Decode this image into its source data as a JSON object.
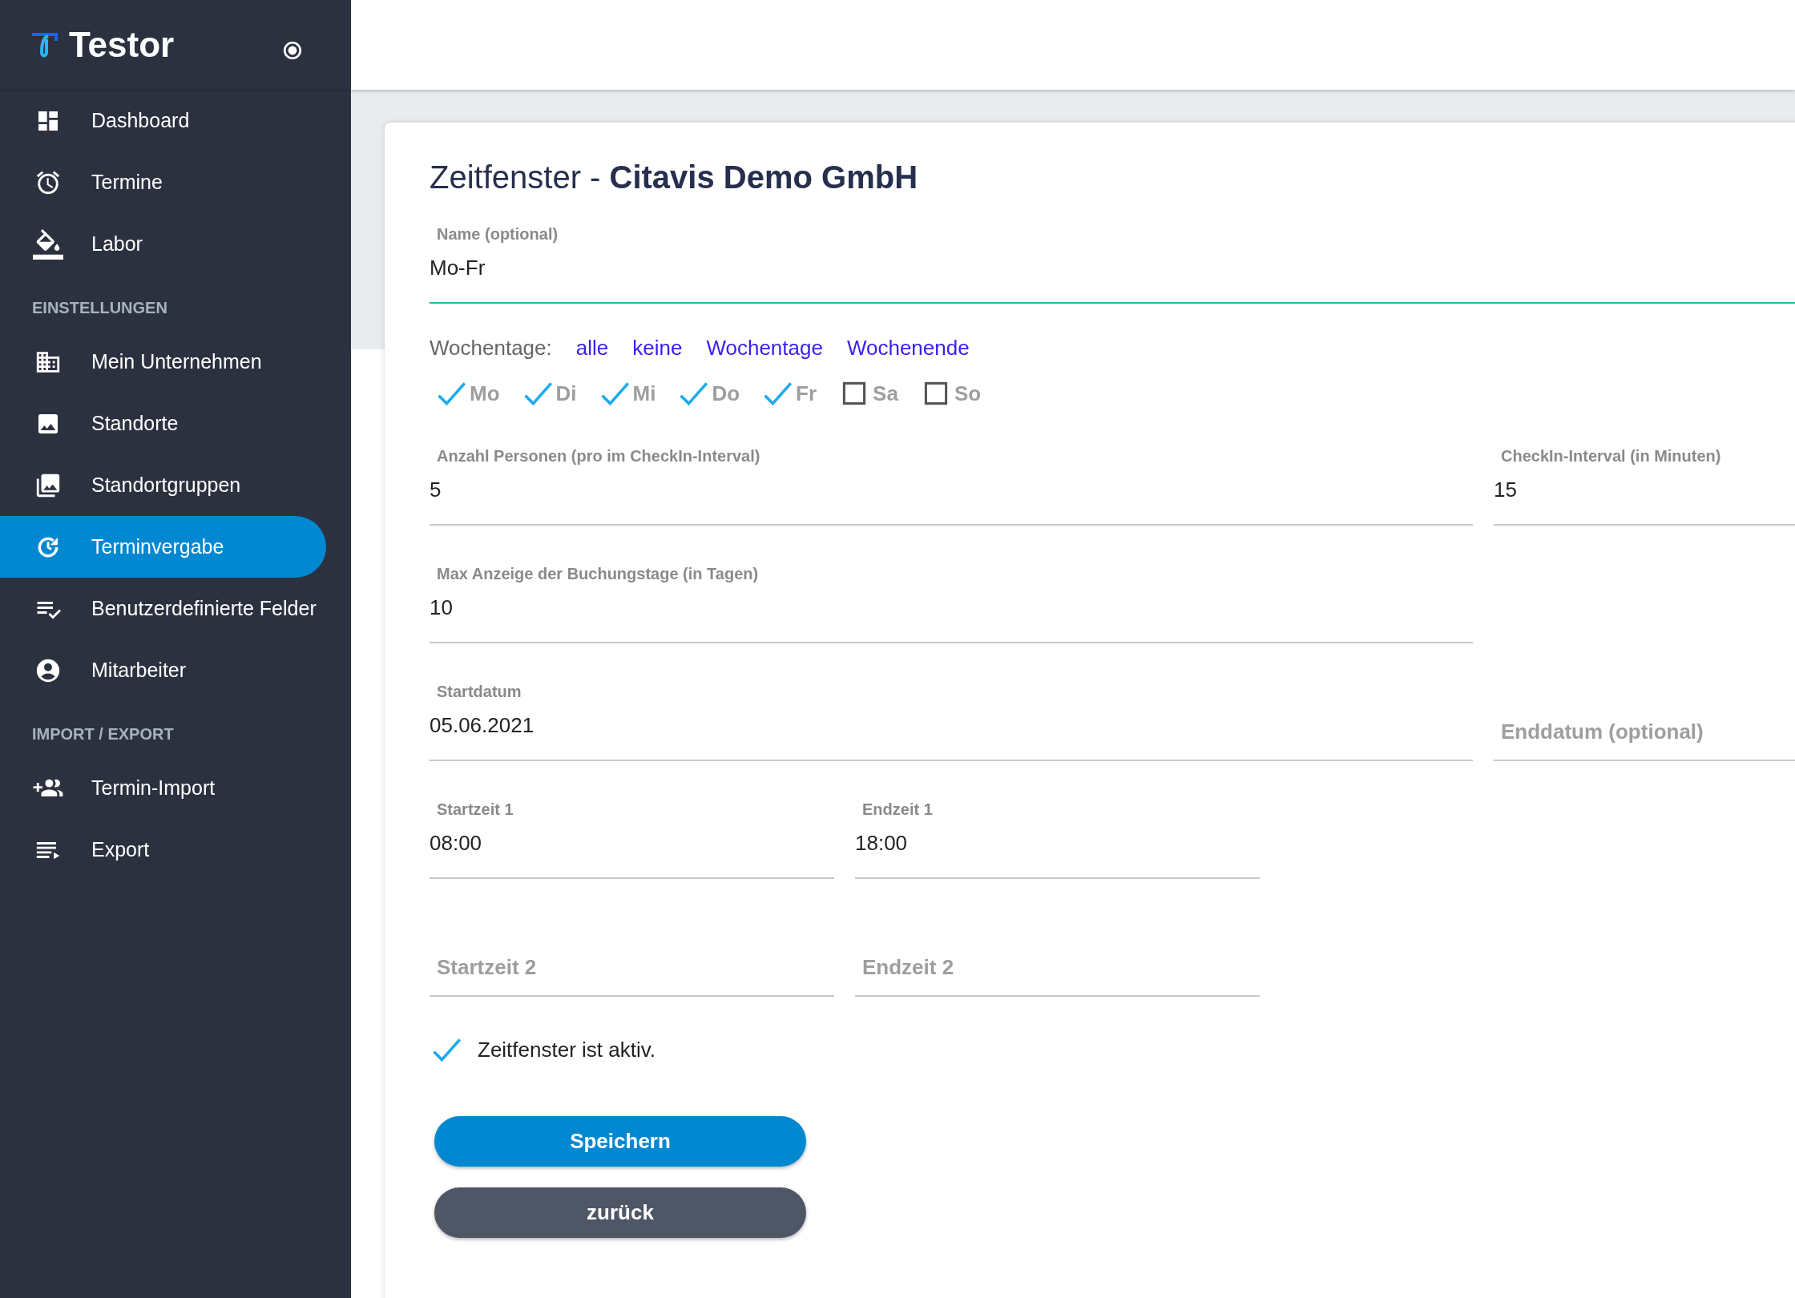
{
  "sidebar": {
    "brand": "Testor",
    "items": [
      {
        "kind": "link",
        "label": "Dashboard",
        "selected": false
      },
      {
        "kind": "link",
        "label": "Termine",
        "selected": false
      },
      {
        "kind": "link",
        "label": "Labor",
        "selected": false
      },
      {
        "kind": "section",
        "label": "EINSTELLUNGEN"
      },
      {
        "kind": "link",
        "label": "Mein Unternehmen",
        "selected": false
      },
      {
        "kind": "link",
        "label": "Standorte",
        "selected": false
      },
      {
        "kind": "link",
        "label": "Standortgruppen",
        "selected": false
      },
      {
        "kind": "link",
        "label": "Terminvergabe",
        "selected": true
      },
      {
        "kind": "link",
        "label": "Benutzerdefinierte Felder",
        "selected": false
      },
      {
        "kind": "link",
        "label": "Mitarbeiter",
        "selected": false
      },
      {
        "kind": "section",
        "label": "IMPORT / EXPORT"
      },
      {
        "kind": "link",
        "label": "Termin-Import",
        "selected": false
      },
      {
        "kind": "link",
        "label": "Export",
        "selected": false
      }
    ]
  },
  "form": {
    "title": "Zeitfenster - **Citavis Demo GmbH**",
    "name_field": {
      "label": "Name (optional)",
      "value": "Mo-Fr",
      "focused": true
    },
    "weekdays": {
      "label": "Wochentage:",
      "links": [
        "alle",
        "keine",
        "Wochentage",
        "Wochenende"
      ],
      "days": [
        {
          "label": "Mo",
          "checked": true
        },
        {
          "label": "Di",
          "checked": true
        },
        {
          "label": "Mi",
          "checked": true
        },
        {
          "label": "Do",
          "checked": true
        },
        {
          "label": "Fr",
          "checked": true
        },
        {
          "label": "Sa",
          "checked": false
        },
        {
          "label": "So",
          "checked": false
        }
      ]
    },
    "rows": [
      {
        "kind": "main_side",
        "fields": [
          {
            "label": "Anzahl Personen (pro im CheckIn-Interval)",
            "value": "5"
          },
          {
            "label": "CheckIn-Interval (in Minuten)",
            "value": "15"
          }
        ]
      },
      {
        "kind": "main_side",
        "fields": [
          {
            "label": "Max Anzeige der Buchungstage (in Tagen)",
            "value": "10"
          }
        ]
      },
      {
        "kind": "main_side",
        "fields": [
          {
            "label": "Startdatum",
            "value": "05.06.2021"
          },
          {
            "placeholder": "Enddatum (optional)"
          }
        ]
      },
      {
        "kind": "times",
        "fields": [
          {
            "label": "Startzeit 1",
            "value": "08:00"
          },
          {
            "label": "Endzeit 1",
            "value": "18:00"
          }
        ]
      },
      {
        "kind": "times",
        "fields": [
          {
            "placeholder": "Startzeit 2"
          },
          {
            "placeholder": "Endzeit 2"
          }
        ]
      }
    ],
    "active": {
      "label": "Zeitfenster ist aktiv.",
      "checked": true
    },
    "buttons": [
      {
        "kind": "primary",
        "label": "Speichern"
      },
      {
        "kind": "secondary",
        "label": "zurück"
      }
    ]
  }
}
